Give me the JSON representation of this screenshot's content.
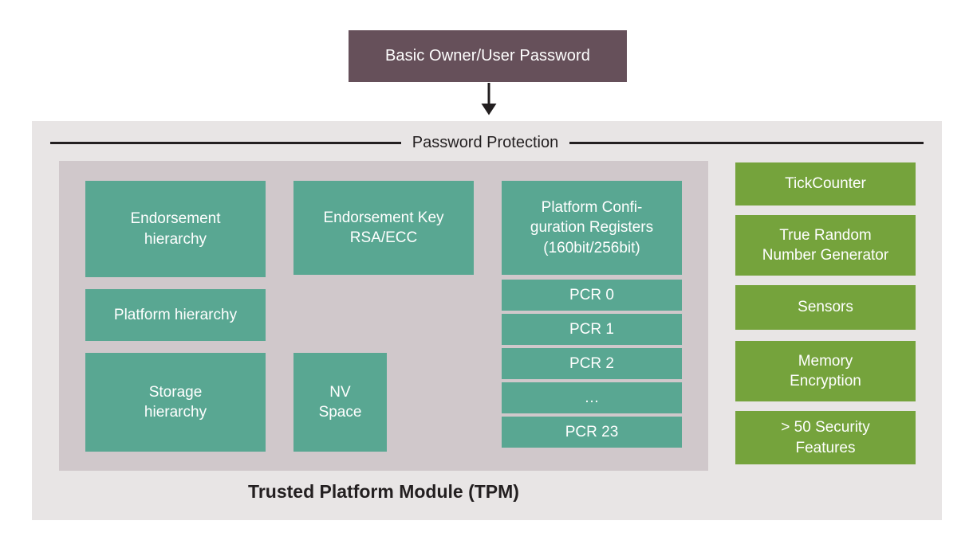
{
  "diagram": {
    "title": "Trusted Platform Module (TPM)",
    "top_box_label": "Basic Owner/User Password",
    "section_header": "Password Protection",
    "colors": {
      "top_box": "#66505a",
      "outer_panel": "#e8e5e5",
      "inner_panel": "#d0c8cb",
      "teal_block": "#59a792",
      "green_block": "#75a33c",
      "rule": "#231f20",
      "block_text": "#ffffff",
      "caption_text": "#231f20"
    },
    "left_column": [
      {
        "label": "Endorsement\nhierarchy",
        "line1": "Endorsement",
        "line2": "hierarchy"
      },
      {
        "label": "Platform hierarchy",
        "line1": "Platform hierarchy",
        "line2": ""
      },
      {
        "label": "Storage\nhierarchy",
        "line1": "Storage",
        "line2": "hierarchy"
      }
    ],
    "middle_column": [
      {
        "label": "Endorsement Key\nRSA/ECC",
        "line1": "Endorsement Key",
        "line2": "RSA/ECC"
      },
      {
        "label": "NV\nSpace",
        "line1": "NV",
        "line2": "Space"
      }
    ],
    "pcr_block": {
      "header_line1": "Platform Confi-",
      "header_line2": "guration Registers",
      "header_line3": "(160bit/256bit)",
      "rows": [
        "PCR 0",
        "PCR 1",
        "PCR 2",
        "…",
        "PCR 23"
      ]
    },
    "right_column": [
      {
        "line1": "TickCounter",
        "line2": ""
      },
      {
        "line1": "True Random",
        "line2": "Number Generator"
      },
      {
        "line1": "Sensors",
        "line2": ""
      },
      {
        "line1": "Memory",
        "line2": "Encryption"
      },
      {
        "line1": "> 50 Security",
        "line2": "Features"
      }
    ]
  }
}
